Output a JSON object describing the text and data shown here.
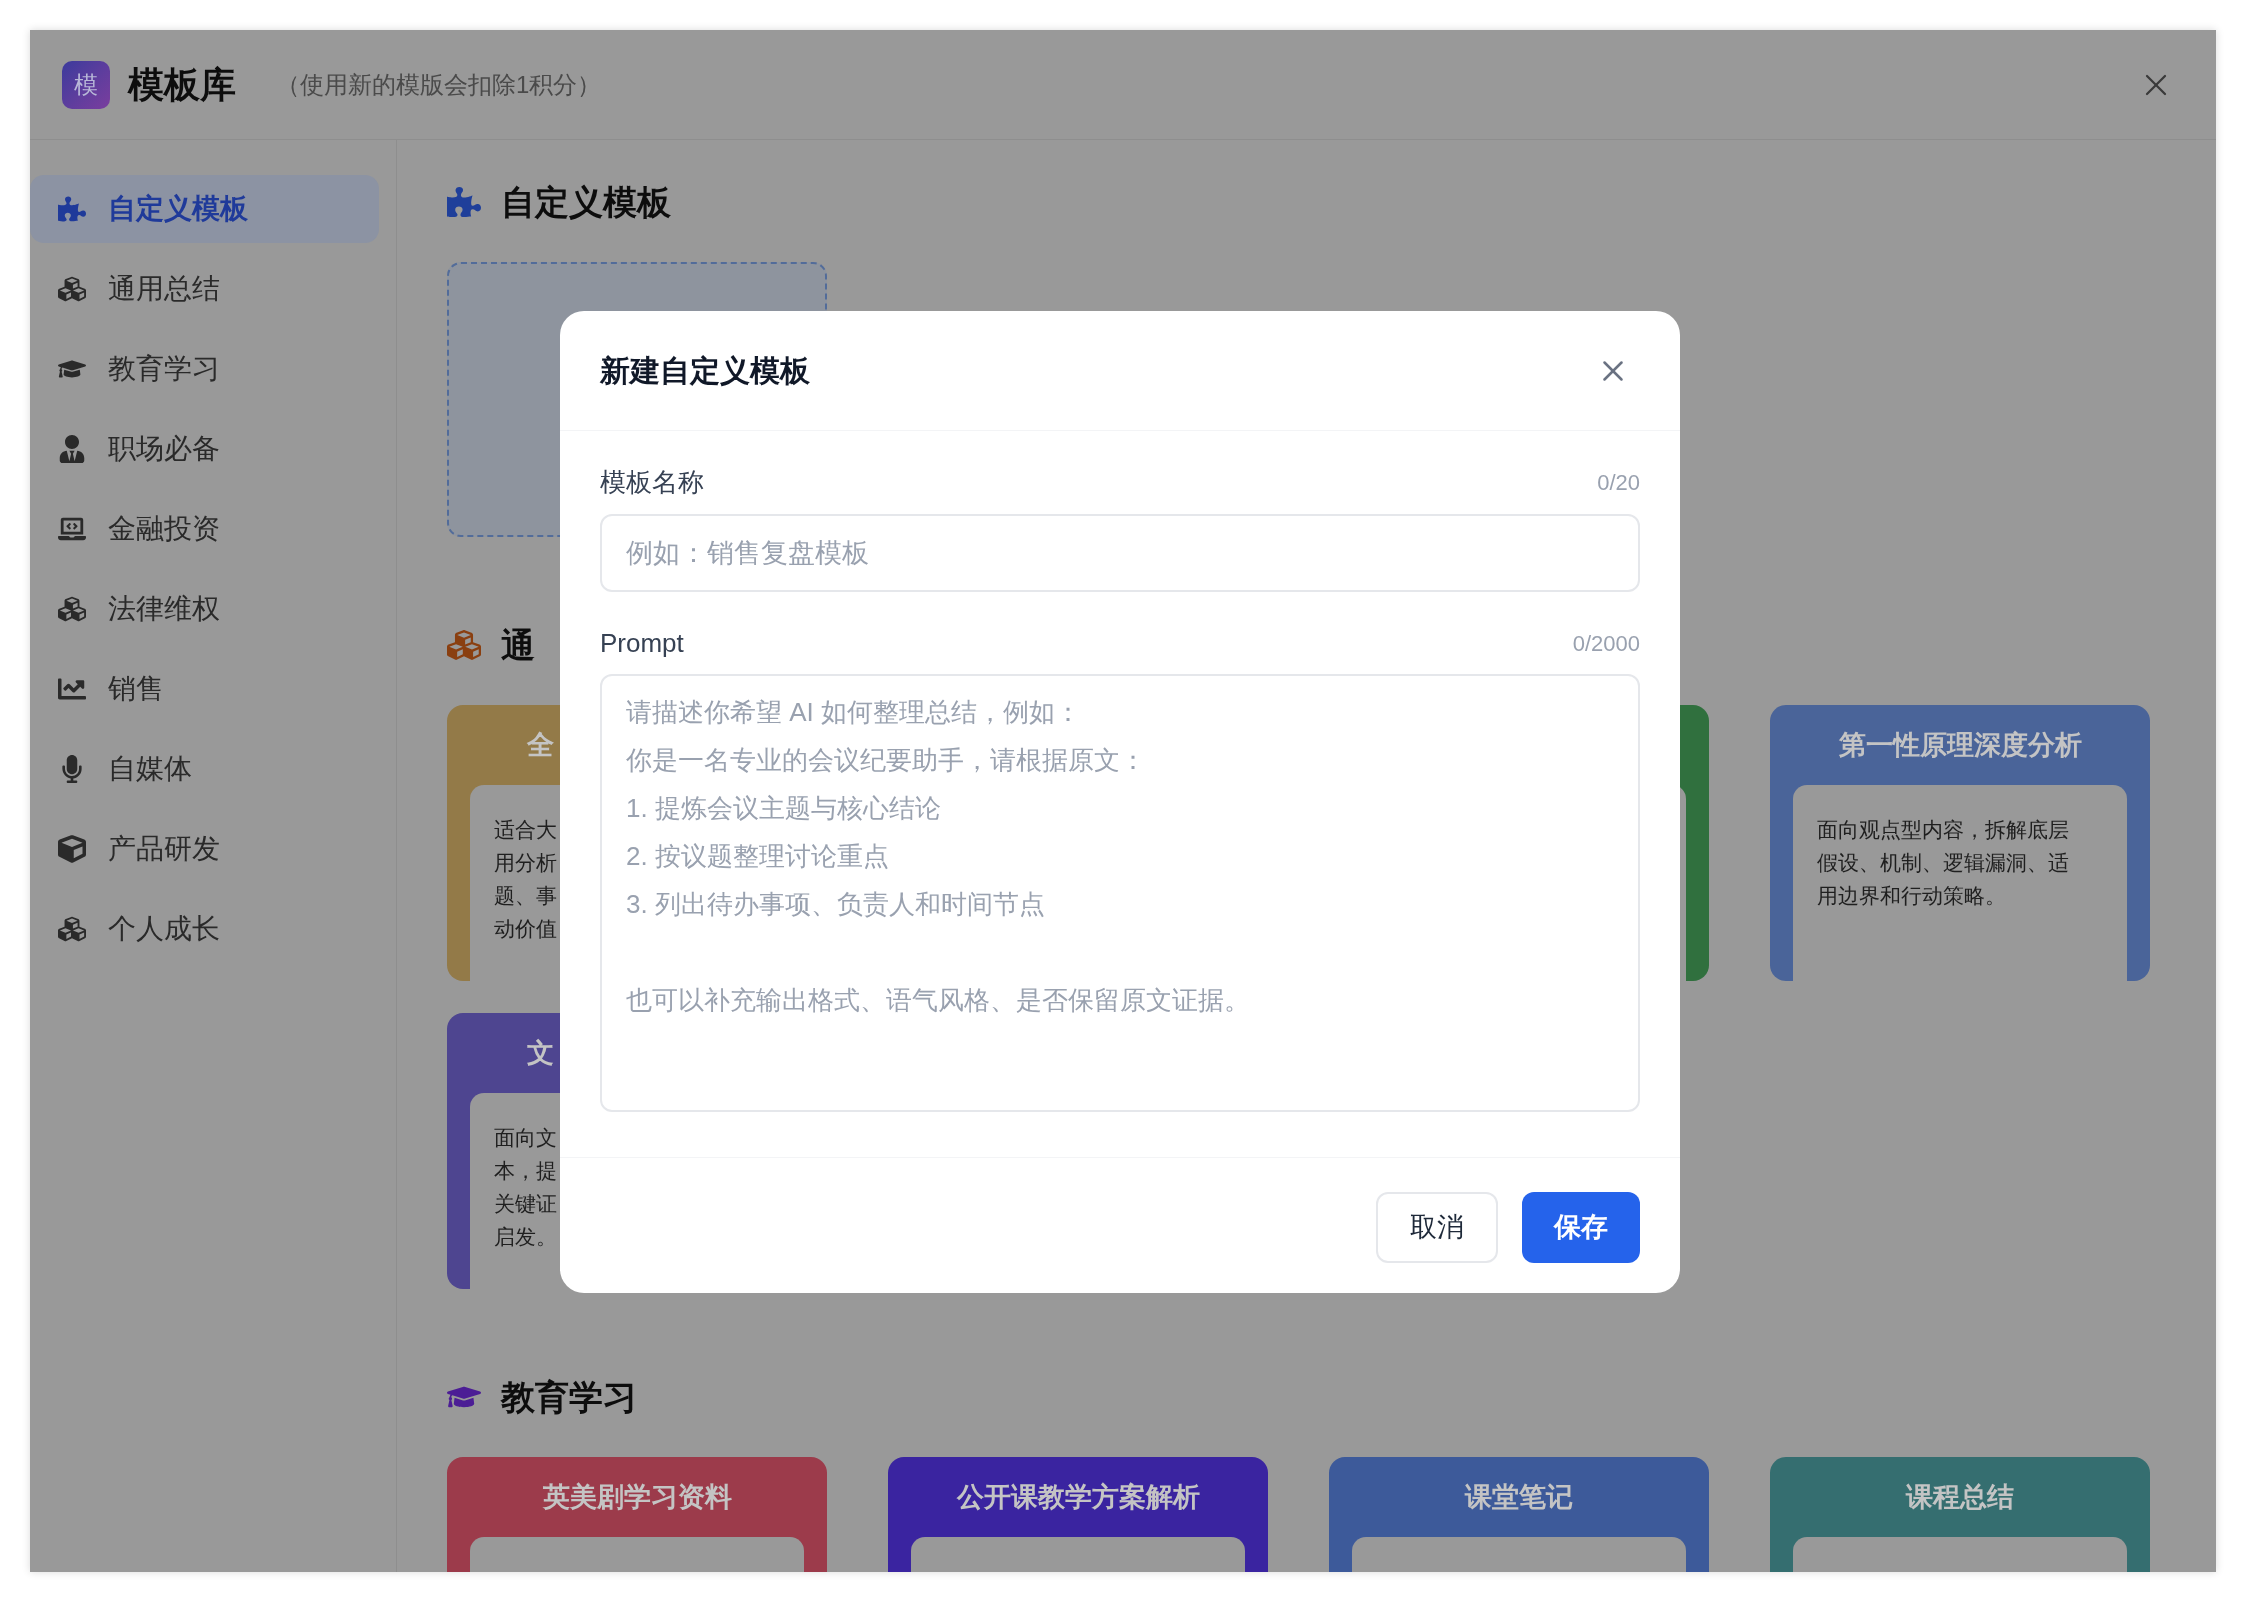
{
  "header": {
    "logo": "模",
    "title": "模板库",
    "subtitle": "（使用新的模版会扣除1积分）"
  },
  "sidebar": {
    "items": [
      {
        "label": "自定义模板",
        "selected": true
      },
      {
        "label": "通用总结",
        "selected": false
      },
      {
        "label": "教育学习",
        "selected": false
      },
      {
        "label": "职场必备",
        "selected": false
      },
      {
        "label": "金融投资",
        "selected": false
      },
      {
        "label": "法律维权",
        "selected": false
      },
      {
        "label": "销售",
        "selected": false
      },
      {
        "label": "自媒体",
        "selected": false
      },
      {
        "label": "产品研发",
        "selected": false
      },
      {
        "label": "个人成长",
        "selected": false
      }
    ]
  },
  "sections": [
    {
      "kind": "custom",
      "title": "自定义模板"
    },
    {
      "kind": "cards",
      "title": "通",
      "cards": [
        {
          "kind": "cut",
          "color": "#937a48",
          "title": "全",
          "lines": [
            "适合大",
            "用分析",
            "题、事",
            "动价值"
          ]
        },
        {
          "kind": "covered"
        },
        {
          "kind": "sliver",
          "color": "#30703e"
        },
        {
          "kind": "full",
          "color": "#4a6499",
          "title": "第一性原理深度分析",
          "body": "面向观点型内容，拆解底层假设、机制、逻辑漏洞、适用边界和行动策略。"
        },
        {
          "kind": "cut",
          "color": "#4e4590",
          "title": "文",
          "lines": [
            "面向文",
            "本，提",
            "关键证",
            "启发。"
          ]
        }
      ]
    },
    {
      "kind": "cards",
      "title": "教育学习",
      "cards": [
        {
          "kind": "full",
          "color": "#9c3b4b",
          "title": "英美剧学习资料"
        },
        {
          "kind": "full",
          "color": "#3a24a0",
          "title": "公开课教学方案解析"
        },
        {
          "kind": "full",
          "color": "#3d5a9a",
          "title": "课堂笔记"
        },
        {
          "kind": "full",
          "color": "#356e70",
          "title": "课程总结"
        }
      ]
    }
  ],
  "dialog": {
    "title": "新建自定义模板",
    "name_field": {
      "label": "模板名称",
      "count": "0/20",
      "placeholder": "例如：销售复盘模板"
    },
    "prompt_field": {
      "label": "Prompt",
      "count": "0/2000",
      "placeholder_lines": [
        "请描述你希望 AI 如何整理总结，例如：",
        "你是一名专业的会议纪要助手，请根据原文：",
        "1. 提炼会议主题与核心结论",
        "2. 按议题整理讨论重点",
        "3. 列出待办事项、负责人和时间节点",
        "也可以补充输出格式、语气风格、是否保留原文证据。"
      ]
    },
    "buttons": [
      {
        "label": "取消",
        "kind": "secondary"
      },
      {
        "label": "保存",
        "kind": "primary"
      }
    ]
  }
}
